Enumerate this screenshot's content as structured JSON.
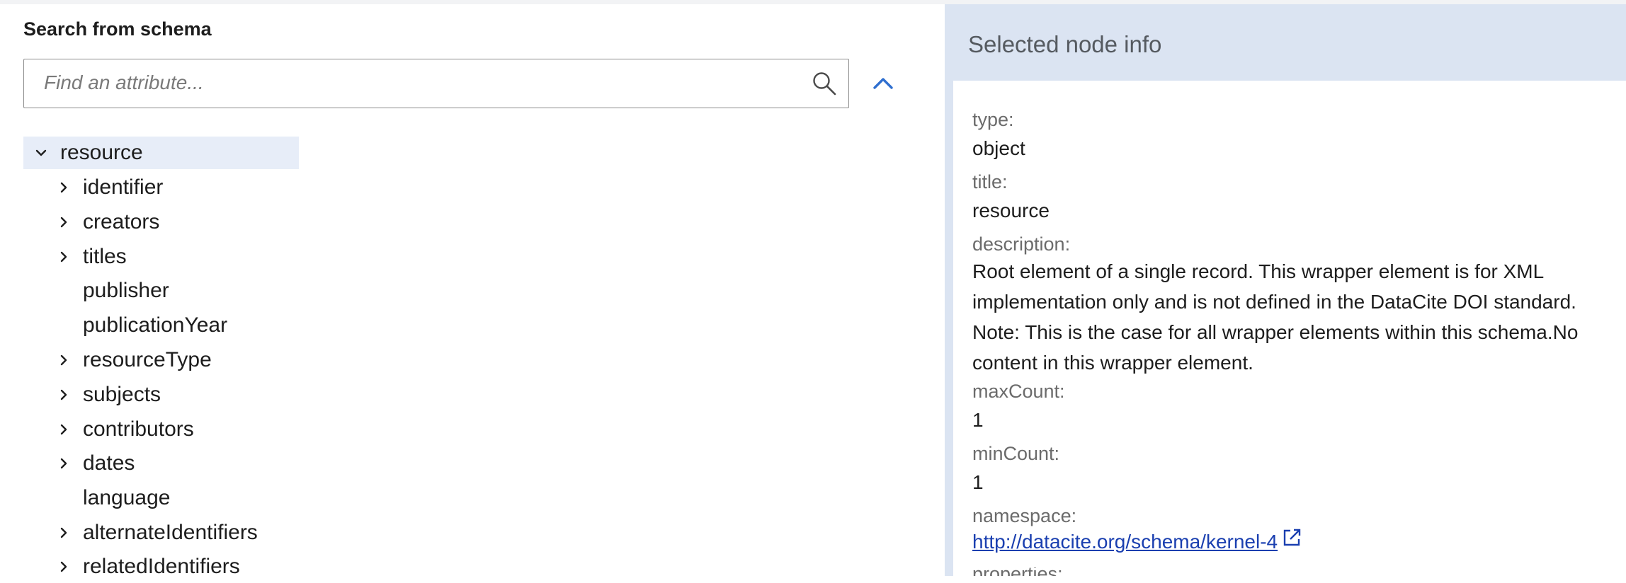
{
  "search": {
    "title": "Search from schema",
    "placeholder": "Find an attribute..."
  },
  "icons": {
    "search": "search-icon",
    "collapse": "chevron-up-icon",
    "expand": "chevron-right-icon",
    "expanded": "chevron-down-icon",
    "external": "external-link-icon"
  },
  "colors": {
    "selected_row": "#e7edf8",
    "panel_bg": "#dbe4f2",
    "accent": "#2f6fcf",
    "link": "#1a3fb0"
  },
  "tree": {
    "root": {
      "label": "resource",
      "expanded": true,
      "selected": true
    },
    "children": [
      {
        "label": "identifier",
        "has_children": true
      },
      {
        "label": "creators",
        "has_children": true
      },
      {
        "label": "titles",
        "has_children": true
      },
      {
        "label": "publisher",
        "has_children": false
      },
      {
        "label": "publicationYear",
        "has_children": false
      },
      {
        "label": "resourceType",
        "has_children": true
      },
      {
        "label": "subjects",
        "has_children": true
      },
      {
        "label": "contributors",
        "has_children": true
      },
      {
        "label": "dates",
        "has_children": true
      },
      {
        "label": "language",
        "has_children": false
      },
      {
        "label": "alternateIdentifiers",
        "has_children": true
      },
      {
        "label": "relatedIdentifiers",
        "has_children": true
      }
    ]
  },
  "node_info": {
    "title": "Selected node info",
    "type_label": "type:",
    "type_value": "object",
    "title_label": "title:",
    "title_value": "resource",
    "description_label": "description:",
    "description_value": "Root element of a single record. This wrapper element is for XML implementation only and is not defined in the DataCite DOI standard. Note: This is the case for all wrapper elements within this schema.No content in this wrapper element.",
    "maxcount_label": "maxCount:",
    "maxcount_value": "1",
    "mincount_label": "minCount:",
    "mincount_value": "1",
    "namespace_label": "namespace:",
    "namespace_value": "http://datacite.org/schema/kernel-4",
    "cutoff_label": "properties:"
  }
}
